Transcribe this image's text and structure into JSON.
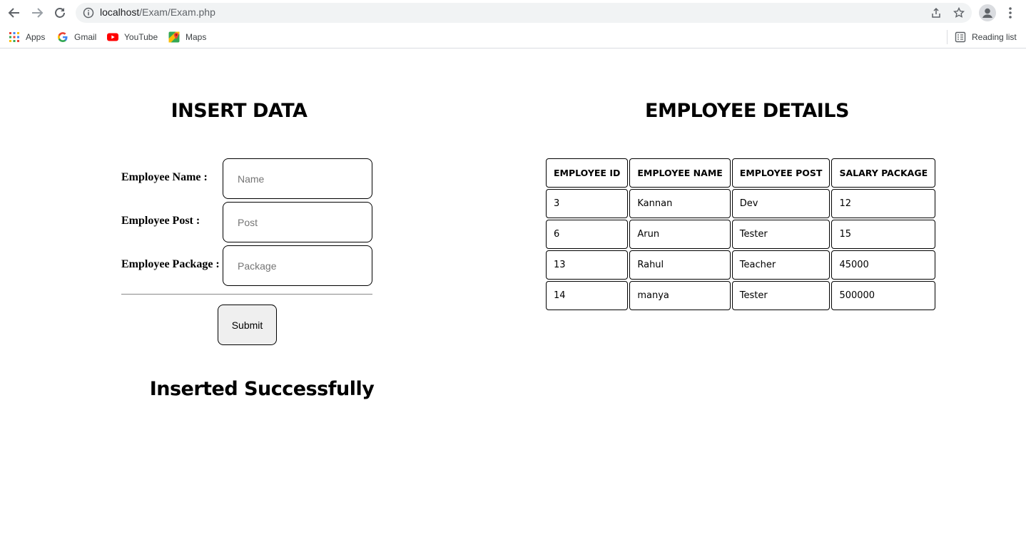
{
  "browser": {
    "url_host": "localhost",
    "url_path": "/Exam/Exam.php",
    "bookmarks": [
      {
        "label": "Apps",
        "icon": "apps-grid-icon"
      },
      {
        "label": "Gmail",
        "icon": "google-icon"
      },
      {
        "label": "YouTube",
        "icon": "youtube-icon"
      },
      {
        "label": "Maps",
        "icon": "maps-icon"
      }
    ],
    "reading_list": "Reading list"
  },
  "insert": {
    "title": "INSERT DATA",
    "fields": [
      {
        "label": "Employee Name :",
        "placeholder": "Name",
        "value": ""
      },
      {
        "label": "Employee Post :",
        "placeholder": "Post",
        "value": ""
      },
      {
        "label": "Employee Package :",
        "placeholder": "Package",
        "value": ""
      }
    ],
    "submit_label": "Submit",
    "message": "Inserted Successfully"
  },
  "details": {
    "title": "EMPLOYEE DETAILS",
    "headers": [
      "EMPLOYEE ID",
      "EMPLOYEE NAME",
      "EMPLOYEE POST",
      "SALARY PACKAGE"
    ],
    "rows": [
      [
        "3",
        "Kannan",
        "Dev",
        "12"
      ],
      [
        "6",
        "Arun",
        "Tester",
        "15"
      ],
      [
        "13",
        "Rahul",
        "Teacher",
        "45000"
      ],
      [
        "14",
        "manya",
        "Tester",
        "500000"
      ]
    ]
  },
  "colors": {
    "omnibox_bg": "#f1f3f4",
    "youtube_red": "#ff0000",
    "button_bg": "#efefef"
  }
}
